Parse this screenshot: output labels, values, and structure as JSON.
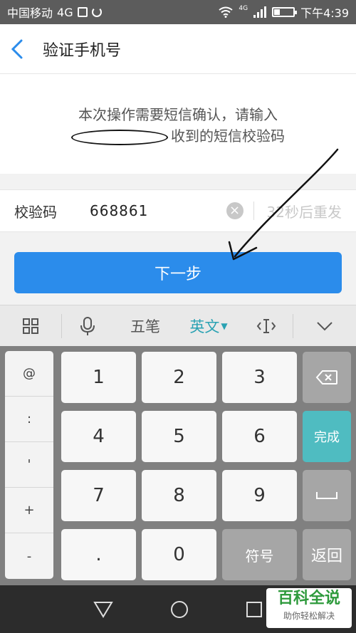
{
  "status_bar": {
    "carrier": "中国移动",
    "network": "4G",
    "network_small": "4G",
    "time": "下午4:39"
  },
  "navbar": {
    "back_icon": "chevron-left-icon",
    "title": "验证手机号"
  },
  "notice": {
    "line1": "本次操作需要短信确认，请输入",
    "line2_suffix": "收到的短信校验码"
  },
  "code_row": {
    "label": "校验码",
    "value": "668861",
    "clear_icon": "clear-circle-icon",
    "resend": "32秒后重发"
  },
  "next_button": {
    "label": "下一步",
    "color": "#2b8ceb"
  },
  "ime_toolbar": {
    "grid_icon": "grid-icon",
    "mic_icon": "microphone-icon",
    "wubi": "五笔",
    "english": "英文",
    "cursor_icon": "text-cursor-icon",
    "collapse_icon": "chevron-down-icon",
    "active_color": "#2aa2b3"
  },
  "keyboard": {
    "symbols": [
      "@",
      ":",
      "'",
      "+",
      "-"
    ],
    "keys": [
      "1",
      "2",
      "3",
      "4",
      "5",
      "6",
      "7",
      "8",
      "9",
      ".",
      "0"
    ],
    "fuhao": "符号",
    "done": "完成",
    "back": "返回",
    "backspace_icon": "backspace-icon",
    "space_icon": "space-bar-icon"
  },
  "system_nav": {
    "back_icon": "triangle-back-icon",
    "home_icon": "circle-home-icon",
    "recent_icon": "square-recent-icon"
  },
  "watermark": {
    "title": "百科全说",
    "subtitle": "助你轻松解决"
  }
}
